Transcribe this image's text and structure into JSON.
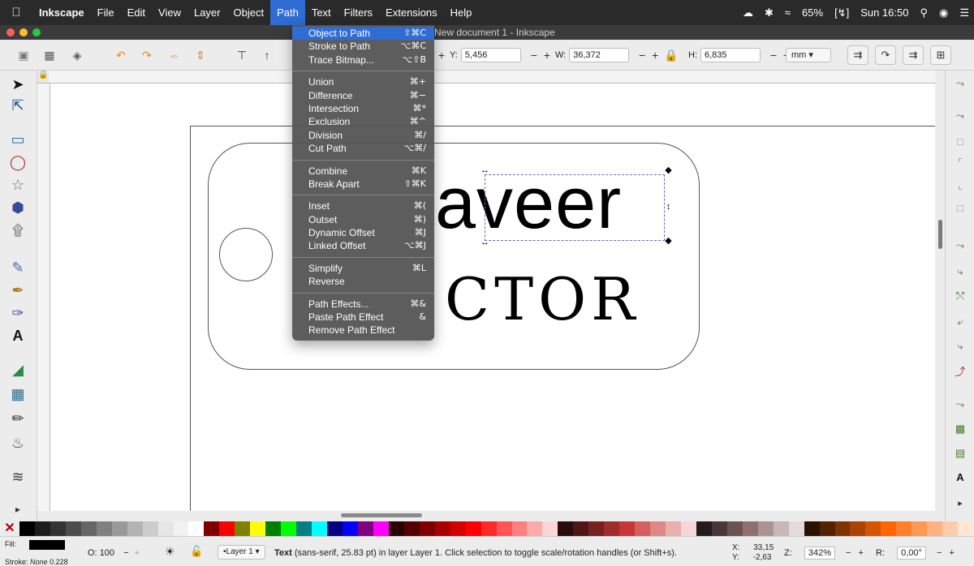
{
  "menubar": {
    "apple_icon": "apple-icon",
    "items": [
      {
        "label": "Inkscape"
      },
      {
        "label": "File"
      },
      {
        "label": "Edit"
      },
      {
        "label": "View"
      },
      {
        "label": "Layer"
      },
      {
        "label": "Object"
      },
      {
        "label": "Path"
      },
      {
        "label": "Text"
      },
      {
        "label": "Filters"
      },
      {
        "label": "Extensions"
      },
      {
        "label": "Help"
      }
    ],
    "status": {
      "battery": "65%",
      "clock": "Sun 16:50"
    }
  },
  "window": {
    "title": "New document 1 - Inkscape"
  },
  "path_menu": {
    "groups": [
      [
        {
          "label": "Object to Path",
          "shortcut": "⇧⌘C",
          "highlighted": true
        },
        {
          "label": "Stroke to Path",
          "shortcut": "⌥⌘C"
        },
        {
          "label": "Trace Bitmap...",
          "shortcut": "⌥⇧B"
        }
      ],
      [
        {
          "label": "Union",
          "shortcut": "⌘+"
        },
        {
          "label": "Difference",
          "shortcut": "⌘−"
        },
        {
          "label": "Intersection",
          "shortcut": "⌘*"
        },
        {
          "label": "Exclusion",
          "shortcut": "⌘^"
        },
        {
          "label": "Division",
          "shortcut": "⌘/"
        },
        {
          "label": "Cut Path",
          "shortcut": "⌥⌘/"
        }
      ],
      [
        {
          "label": "Combine",
          "shortcut": "⌘K"
        },
        {
          "label": "Break Apart",
          "shortcut": "⇧⌘K"
        }
      ],
      [
        {
          "label": "Inset",
          "shortcut": "⌘("
        },
        {
          "label": "Outset",
          "shortcut": "⌘)"
        },
        {
          "label": "Dynamic Offset",
          "shortcut": "⌘J"
        },
        {
          "label": "Linked Offset",
          "shortcut": "⌥⌘J"
        }
      ],
      [
        {
          "label": "Simplify",
          "shortcut": "⌘L"
        },
        {
          "label": "Reverse",
          "shortcut": ""
        }
      ],
      [
        {
          "label": "Path Effects...",
          "shortcut": "⌘&"
        },
        {
          "label": "Paste Path Effect",
          "shortcut": "&"
        },
        {
          "label": "Remove Path Effect",
          "shortcut": ""
        }
      ]
    ]
  },
  "toolbar": {
    "y_label": "Y:",
    "y_value": "5,456",
    "w_label": "W:",
    "w_value": "36,372",
    "h_label": "H:",
    "h_value": "6,835",
    "units": "mm ▾"
  },
  "canvas": {
    "big_text": "aveer",
    "sub_text": "CTOR"
  },
  "statusbar": {
    "fill_label": "Fill:",
    "stroke_label": "Stroke:",
    "stroke_value": "None",
    "stroke_width": "0.228",
    "opacity_label": "O:",
    "opacity_value": "100",
    "layer": "•Layer 1 ▾",
    "message_prefix": "Text",
    "message": "(sans-serif, 25.83 pt) in layer Layer 1. Click selection to toggle scale/rotation handles (or Shift+s).",
    "x_label": "X:",
    "x_value": "33,15",
    "y_label": "Y:",
    "y_value": "-2,63",
    "zoom_label": "Z:",
    "zoom_value": "342%",
    "rotation_label": "R:",
    "rotation_value": "0,00°"
  },
  "palette": {
    "colors": [
      "#000000",
      "#1c1c1c",
      "#333333",
      "#4d4d4d",
      "#666666",
      "#808080",
      "#999999",
      "#b3b3b3",
      "#cccccc",
      "#e6e6e6",
      "#f2f2f2",
      "#ffffff",
      "#800000",
      "#ff0000",
      "#808000",
      "#ffff00",
      "#008000",
      "#00ff00",
      "#008080",
      "#00ffff",
      "#000080",
      "#0000ff",
      "#800080",
      "#ff00ff",
      "#2b0000",
      "#550000",
      "#800000",
      "#aa0000",
      "#d40000",
      "#ff0000",
      "#ff2a2a",
      "#ff5555",
      "#ff8080",
      "#ffaaaa",
      "#ffd5d5",
      "#280b0b",
      "#501616",
      "#782121",
      "#a02c2c",
      "#c83737",
      "#d35f5f",
      "#de8787",
      "#e9afaf",
      "#f4d7d7",
      "#241c1c",
      "#483737",
      "#6c5353",
      "#916f6f",
      "#ac9393",
      "#c8b7b7",
      "#e3dbdb",
      "#2b1100",
      "#552200",
      "#803300",
      "#aa4400",
      "#d45500",
      "#ff6600",
      "#ff7f2a",
      "#ff9955",
      "#ffb380",
      "#ffccaa",
      "#ffe6d5"
    ]
  }
}
